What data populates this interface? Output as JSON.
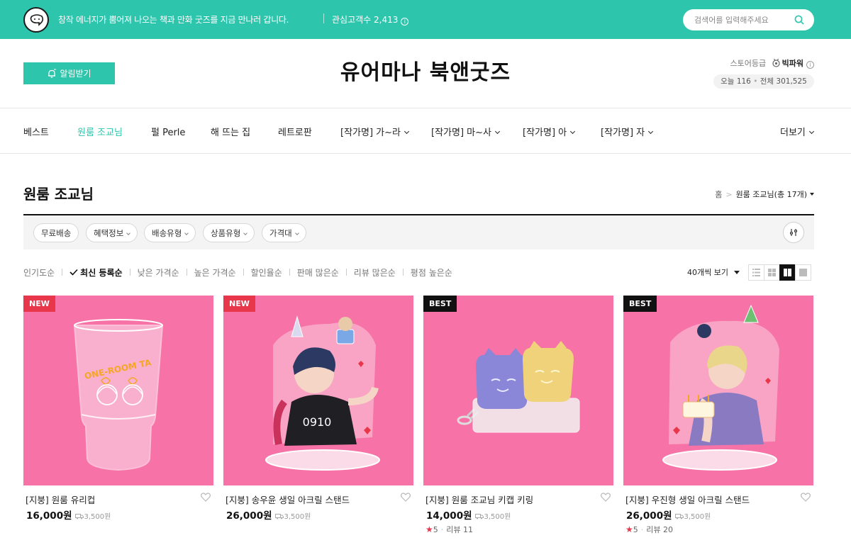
{
  "topbar": {
    "tagline": "창작 에너지가 뿜어져 나오는 책과 만화 굿즈를 지금 만나러 갑니다.",
    "fans_label": "관심고객수",
    "fans_count": "2,413",
    "search_placeholder": "검색어를 입력해주세요"
  },
  "header": {
    "notify_label": "알림받기",
    "store_name": "유어마나 북앤굿즈",
    "grade_label": "스토어등급",
    "grade_value": "빅파워",
    "visit_today_label": "오늘",
    "visit_today": "116",
    "visit_total_label": "전체",
    "visit_total": "301,525"
  },
  "nav": {
    "items": [
      {
        "label": "베스트"
      },
      {
        "label": "원룸 조교님"
      },
      {
        "label": "펄 Perle"
      },
      {
        "label": "해 뜨는 집"
      },
      {
        "label": "레트로판"
      },
      {
        "label": "[작가명] 가~라"
      },
      {
        "label": "[작가명] 마~사"
      },
      {
        "label": "[작가명] 아"
      },
      {
        "label": "[작가명] 자"
      }
    ],
    "more_label": "더보기"
  },
  "page": {
    "title": "원룸 조교님",
    "breadcrumb_home": "홈",
    "breadcrumb_current": "원룸 조교님",
    "breadcrumb_count": "(총 17개)"
  },
  "filters": [
    "무료배송",
    "혜택정보",
    "배송유형",
    "상품유형",
    "가격대"
  ],
  "sort": {
    "options": [
      "인기도순",
      "최신 등록순",
      "낮은 가격순",
      "높은 가격순",
      "할인율순",
      "판매 많은순",
      "리뷰 많은순",
      "평점 높은순"
    ],
    "selected": "최신 등록순",
    "page_size": "40개씩 보기"
  },
  "products": [
    {
      "badge": "NEW",
      "name": "[지붕] 원룸 유리컵",
      "price": "16,000원",
      "shipping": "3,500원",
      "rating": "",
      "reviews_label": "",
      "reviews": ""
    },
    {
      "badge": "NEW",
      "name": "[지붕] 송우윤 생일 아크릴 스탠드",
      "price": "26,000원",
      "shipping": "3,500원",
      "rating": "",
      "reviews_label": "",
      "reviews": ""
    },
    {
      "badge": "BEST",
      "name": "[지붕] 원룸 조교님 키캡 키링",
      "price": "14,000원",
      "shipping": "3,500원",
      "rating": "5",
      "reviews_label": "리뷰",
      "reviews": "11"
    },
    {
      "badge": "BEST",
      "name": "[지붕] 우진형 생일 아크릴 스탠드",
      "price": "26,000원",
      "shipping": "3,500원",
      "rating": "5",
      "reviews_label": "리뷰",
      "reviews": "20"
    }
  ],
  "colors": {
    "brand": "#2ec5ad",
    "thumb_bg": "#f773a7",
    "badge_new": "#e8374b",
    "badge_best": "#111111"
  },
  "icons": {
    "logo": "speech-bubble-logo-icon",
    "search": "search-icon",
    "bell": "bell-plus-icon",
    "info": "info-icon",
    "grade": "grade-medal-icon",
    "settings": "filter-settings-icon",
    "check": "check-icon",
    "heart": "heart-outline-icon",
    "shipping": "truck-icon",
    "star": "star-icon"
  }
}
